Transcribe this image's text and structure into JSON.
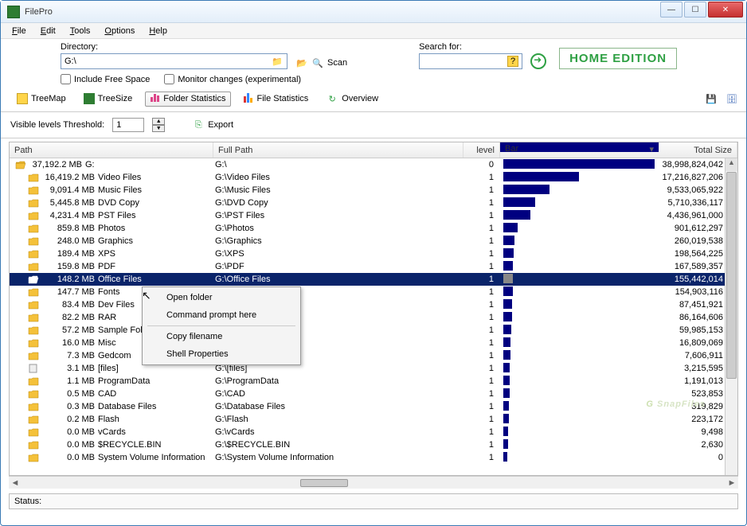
{
  "app": {
    "title": "FilePro",
    "edition": "HOME EDITION"
  },
  "menu": {
    "file": "File",
    "edit": "Edit",
    "tools": "Tools",
    "options": "Options",
    "help": "Help"
  },
  "toolbar": {
    "directory_label": "Directory:",
    "directory_value": "G:\\",
    "scan": "Scan",
    "search_label": "Search for:",
    "help_tip": "?",
    "include_free": "Include Free Space",
    "monitor_changes": "Monitor changes (experimental)"
  },
  "tabs": {
    "treemap": "TreeMap",
    "treesize": "TreeSize",
    "folder_stats": "Folder Statistics",
    "file_stats": "File Statistics",
    "overview": "Overview"
  },
  "subtool": {
    "visible_label": "Visible levels Threshold:",
    "visible_value": "1",
    "export": "Export"
  },
  "columns": {
    "path": "Path",
    "full": "Full Path",
    "level": "level",
    "bar": "Bar",
    "size": "Total Size"
  },
  "context_menu": {
    "open": "Open folder",
    "cmd": "Command prompt here",
    "copy": "Copy filename",
    "shell": "Shell Properties"
  },
  "status": {
    "label": "Status:"
  },
  "watermark": "SnapFiles",
  "rows": [
    {
      "indent": 0,
      "size": "37,192.2 MB",
      "name": "G:",
      "full": "G:\\",
      "level": 0,
      "bar": 190,
      "total": "38,998,824,042",
      "icon": "folder-open"
    },
    {
      "indent": 1,
      "size": "16,419.2 MB",
      "name": "Video Files",
      "full": "G:\\Video Files",
      "level": 1,
      "bar": 95,
      "total": "17,216,827,206",
      "icon": "folder"
    },
    {
      "indent": 1,
      "size": "9,091.4 MB",
      "name": "Music Files",
      "full": "G:\\Music Files",
      "level": 1,
      "bar": 58,
      "total": "9,533,065,922",
      "icon": "folder"
    },
    {
      "indent": 1,
      "size": "5,445.8 MB",
      "name": "DVD Copy",
      "full": "G:\\DVD Copy",
      "level": 1,
      "bar": 40,
      "total": "5,710,336,117",
      "icon": "folder"
    },
    {
      "indent": 1,
      "size": "4,231.4 MB",
      "name": "PST Files",
      "full": "G:\\PST Files",
      "level": 1,
      "bar": 34,
      "total": "4,436,961,000",
      "icon": "folder"
    },
    {
      "indent": 1,
      "size": "859.8 MB",
      "name": "Photos",
      "full": "G:\\Photos",
      "level": 1,
      "bar": 18,
      "total": "901,612,297",
      "icon": "folder"
    },
    {
      "indent": 1,
      "size": "248.0 MB",
      "name": "Graphics",
      "full": "G:\\Graphics",
      "level": 1,
      "bar": 14,
      "total": "260,019,538",
      "icon": "folder"
    },
    {
      "indent": 1,
      "size": "189.4 MB",
      "name": "XPS",
      "full": "G:\\XPS",
      "level": 1,
      "bar": 13,
      "total": "198,564,225",
      "icon": "folder"
    },
    {
      "indent": 1,
      "size": "159.8 MB",
      "name": "PDF",
      "full": "G:\\PDF",
      "level": 1,
      "bar": 12,
      "total": "167,589,357",
      "icon": "folder"
    },
    {
      "indent": 1,
      "size": "148.2 MB",
      "name": "Office Files",
      "full": "G:\\Office Files",
      "level": 1,
      "bar": 12,
      "total": "155,442,014",
      "icon": "folder-open",
      "selected": true
    },
    {
      "indent": 1,
      "size": "147.7 MB",
      "name": "Fonts",
      "full": "",
      "level": 1,
      "bar": 12,
      "total": "154,903,116",
      "icon": "folder"
    },
    {
      "indent": 1,
      "size": "83.4 MB",
      "name": "Dev Files",
      "full": "",
      "level": 1,
      "bar": 11,
      "total": "87,451,921",
      "icon": "folder"
    },
    {
      "indent": 1,
      "size": "82.2 MB",
      "name": "RAR",
      "full": "",
      "level": 1,
      "bar": 11,
      "total": "86,164,606",
      "icon": "folder"
    },
    {
      "indent": 1,
      "size": "57.2 MB",
      "name": "Sample Folde",
      "full": "",
      "level": 1,
      "bar": 10,
      "total": "59,985,153",
      "icon": "folder"
    },
    {
      "indent": 1,
      "size": "16.0 MB",
      "name": "Misc",
      "full": "",
      "level": 1,
      "bar": 9,
      "total": "16,809,069",
      "icon": "folder"
    },
    {
      "indent": 1,
      "size": "7.3 MB",
      "name": "Gedcom",
      "full": "G:\\Gedcom",
      "level": 1,
      "bar": 9,
      "total": "7,606,911",
      "icon": "folder"
    },
    {
      "indent": 1,
      "size": "3.1 MB",
      "name": "[files]",
      "full": "G:\\[files]",
      "level": 1,
      "bar": 8,
      "total": "3,215,595",
      "icon": "file"
    },
    {
      "indent": 1,
      "size": "1.1 MB",
      "name": "ProgramData",
      "full": "G:\\ProgramData",
      "level": 1,
      "bar": 8,
      "total": "1,191,013",
      "icon": "folder"
    },
    {
      "indent": 1,
      "size": "0.5 MB",
      "name": "CAD",
      "full": "G:\\CAD",
      "level": 1,
      "bar": 8,
      "total": "523,853",
      "icon": "folder"
    },
    {
      "indent": 1,
      "size": "0.3 MB",
      "name": "Database Files",
      "full": "G:\\Database Files",
      "level": 1,
      "bar": 7,
      "total": "319,829",
      "icon": "folder"
    },
    {
      "indent": 1,
      "size": "0.2 MB",
      "name": "Flash",
      "full": "G:\\Flash",
      "level": 1,
      "bar": 7,
      "total": "223,172",
      "icon": "folder"
    },
    {
      "indent": 1,
      "size": "0.0 MB",
      "name": "vCards",
      "full": "G:\\vCards",
      "level": 1,
      "bar": 6,
      "total": "9,498",
      "icon": "folder"
    },
    {
      "indent": 1,
      "size": "0.0 MB",
      "name": "$RECYCLE.BIN",
      "full": "G:\\$RECYCLE.BIN",
      "level": 1,
      "bar": 6,
      "total": "2,630",
      "icon": "folder"
    },
    {
      "indent": 1,
      "size": "0.0 MB",
      "name": "System Volume Information",
      "full": "G:\\System Volume Information",
      "level": 1,
      "bar": 5,
      "total": "0",
      "icon": "folder"
    }
  ]
}
